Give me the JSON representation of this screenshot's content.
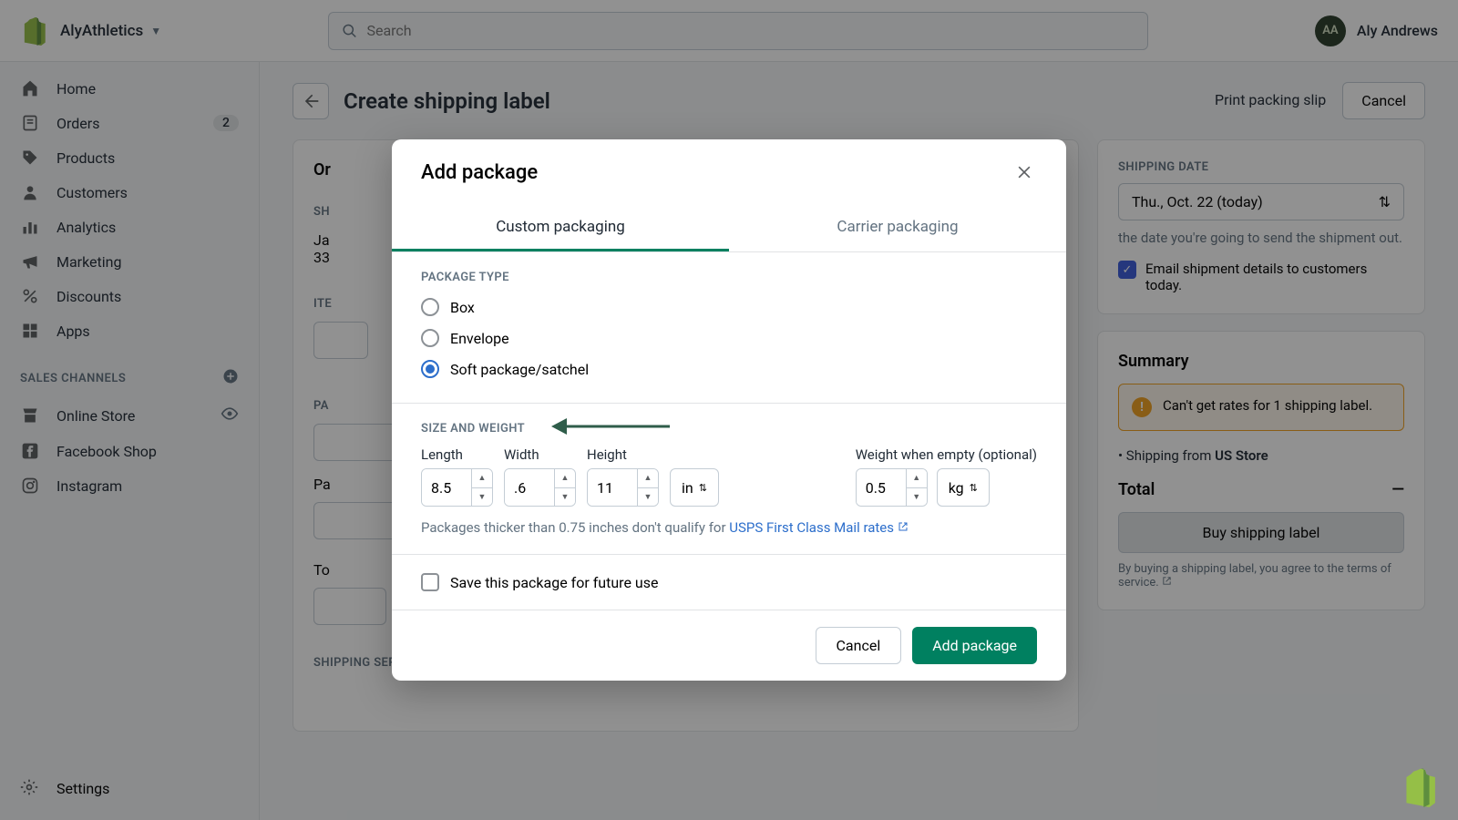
{
  "header": {
    "store_name": "AlyAthletics",
    "search_placeholder": "Search",
    "user_name": "Aly Andrews",
    "avatar_initials": "AA"
  },
  "sidebar": {
    "items": [
      {
        "label": "Home",
        "icon": "home"
      },
      {
        "label": "Orders",
        "icon": "orders",
        "badge": "2"
      },
      {
        "label": "Products",
        "icon": "products"
      },
      {
        "label": "Customers",
        "icon": "customers"
      },
      {
        "label": "Analytics",
        "icon": "analytics"
      },
      {
        "label": "Marketing",
        "icon": "marketing"
      },
      {
        "label": "Discounts",
        "icon": "discounts"
      },
      {
        "label": "Apps",
        "icon": "apps"
      }
    ],
    "section_label": "SALES CHANNELS",
    "channels": [
      {
        "label": "Online Store",
        "icon": "store",
        "trailing": "eye"
      },
      {
        "label": "Facebook Shop",
        "icon": "facebook"
      },
      {
        "label": "Instagram",
        "icon": "instagram"
      }
    ],
    "settings_label": "Settings"
  },
  "page": {
    "title": "Create shipping label",
    "print_slip": "Print packing slip",
    "cancel": "Cancel",
    "orders_hdr": "Or",
    "ship_to": "SH",
    "ship_name": "Ja",
    "ship_addr": "33",
    "items_hdr": "ITE",
    "package_hdr": "PA",
    "pa_label": "Pa",
    "total": "To",
    "shipping_service": "SHIPPING SERVICE"
  },
  "right": {
    "date_label": "SHIPPING DATE",
    "date_value": "Thu., Oct. 22 (today)",
    "date_hint": "the date you're going to send the shipment out.",
    "email_label": "Email shipment details to customers today.",
    "summary_title": "Summary",
    "warn_text": "Can't get rates for 1 shipping label.",
    "ship_from_prefix": "Shipping from ",
    "ship_from_store": "US Store",
    "total_label": "Total",
    "total_value": "—",
    "buy_label": "Buy shipping label",
    "tos_text": "By buying a shipping label, you agree to the terms of service.",
    "tos_link_part": "terms of service"
  },
  "modal": {
    "title": "Add package",
    "tabs": {
      "custom": "Custom packaging",
      "carrier": "Carrier packaging"
    },
    "package_type_label": "PACKAGE TYPE",
    "types": {
      "box": "Box",
      "envelope": "Envelope",
      "soft": "Soft package/satchel"
    },
    "selected_type": "soft",
    "size_label": "SIZE AND WEIGHT",
    "length_label": "Length",
    "width_label": "Width",
    "height_label": "Height",
    "weight_label": "Weight when empty (optional)",
    "length_value": "8.5",
    "width_value": ".6",
    "height_value": "11",
    "dim_unit": "in",
    "weight_value": "0.5",
    "weight_unit": "kg",
    "thickness_note_prefix": "Packages thicker than 0.75 inches don't qualify for ",
    "thickness_link": "USPS First Class Mail rates",
    "save_label": "Save this package for future use",
    "cancel": "Cancel",
    "submit": "Add package"
  },
  "colors": {
    "primary": "#008060",
    "link": "#2c6ecb",
    "warn": "#f0a020"
  }
}
